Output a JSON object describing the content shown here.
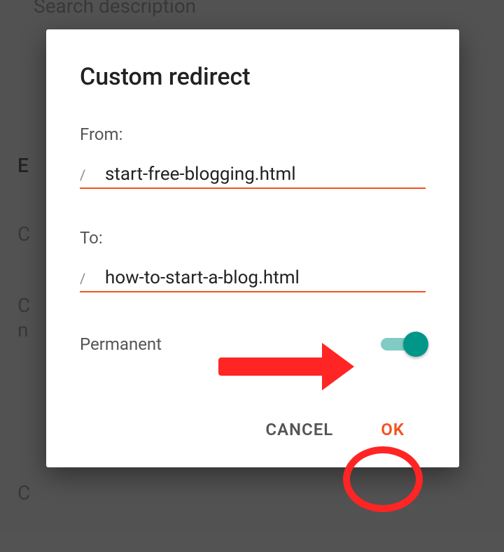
{
  "background": {
    "heading_fragment": "Search description",
    "row_letter_1": "E",
    "row_letter_2": "C",
    "row_letter_3": "C",
    "row_letter_4": "n",
    "row_letter_5": "C"
  },
  "dialog": {
    "title": "Custom redirect",
    "from_label": "From:",
    "to_label": "To:",
    "slash": "/",
    "from_value": "start-free-blogging.html",
    "to_value": "how-to-start-a-blog.html",
    "permanent_label": "Permanent",
    "permanent_on": true,
    "cancel_label": "CANCEL",
    "ok_label": "OK"
  },
  "colors": {
    "accent": "#f4511e",
    "switch_on": "#009688",
    "annotation": "#ff2525"
  }
}
